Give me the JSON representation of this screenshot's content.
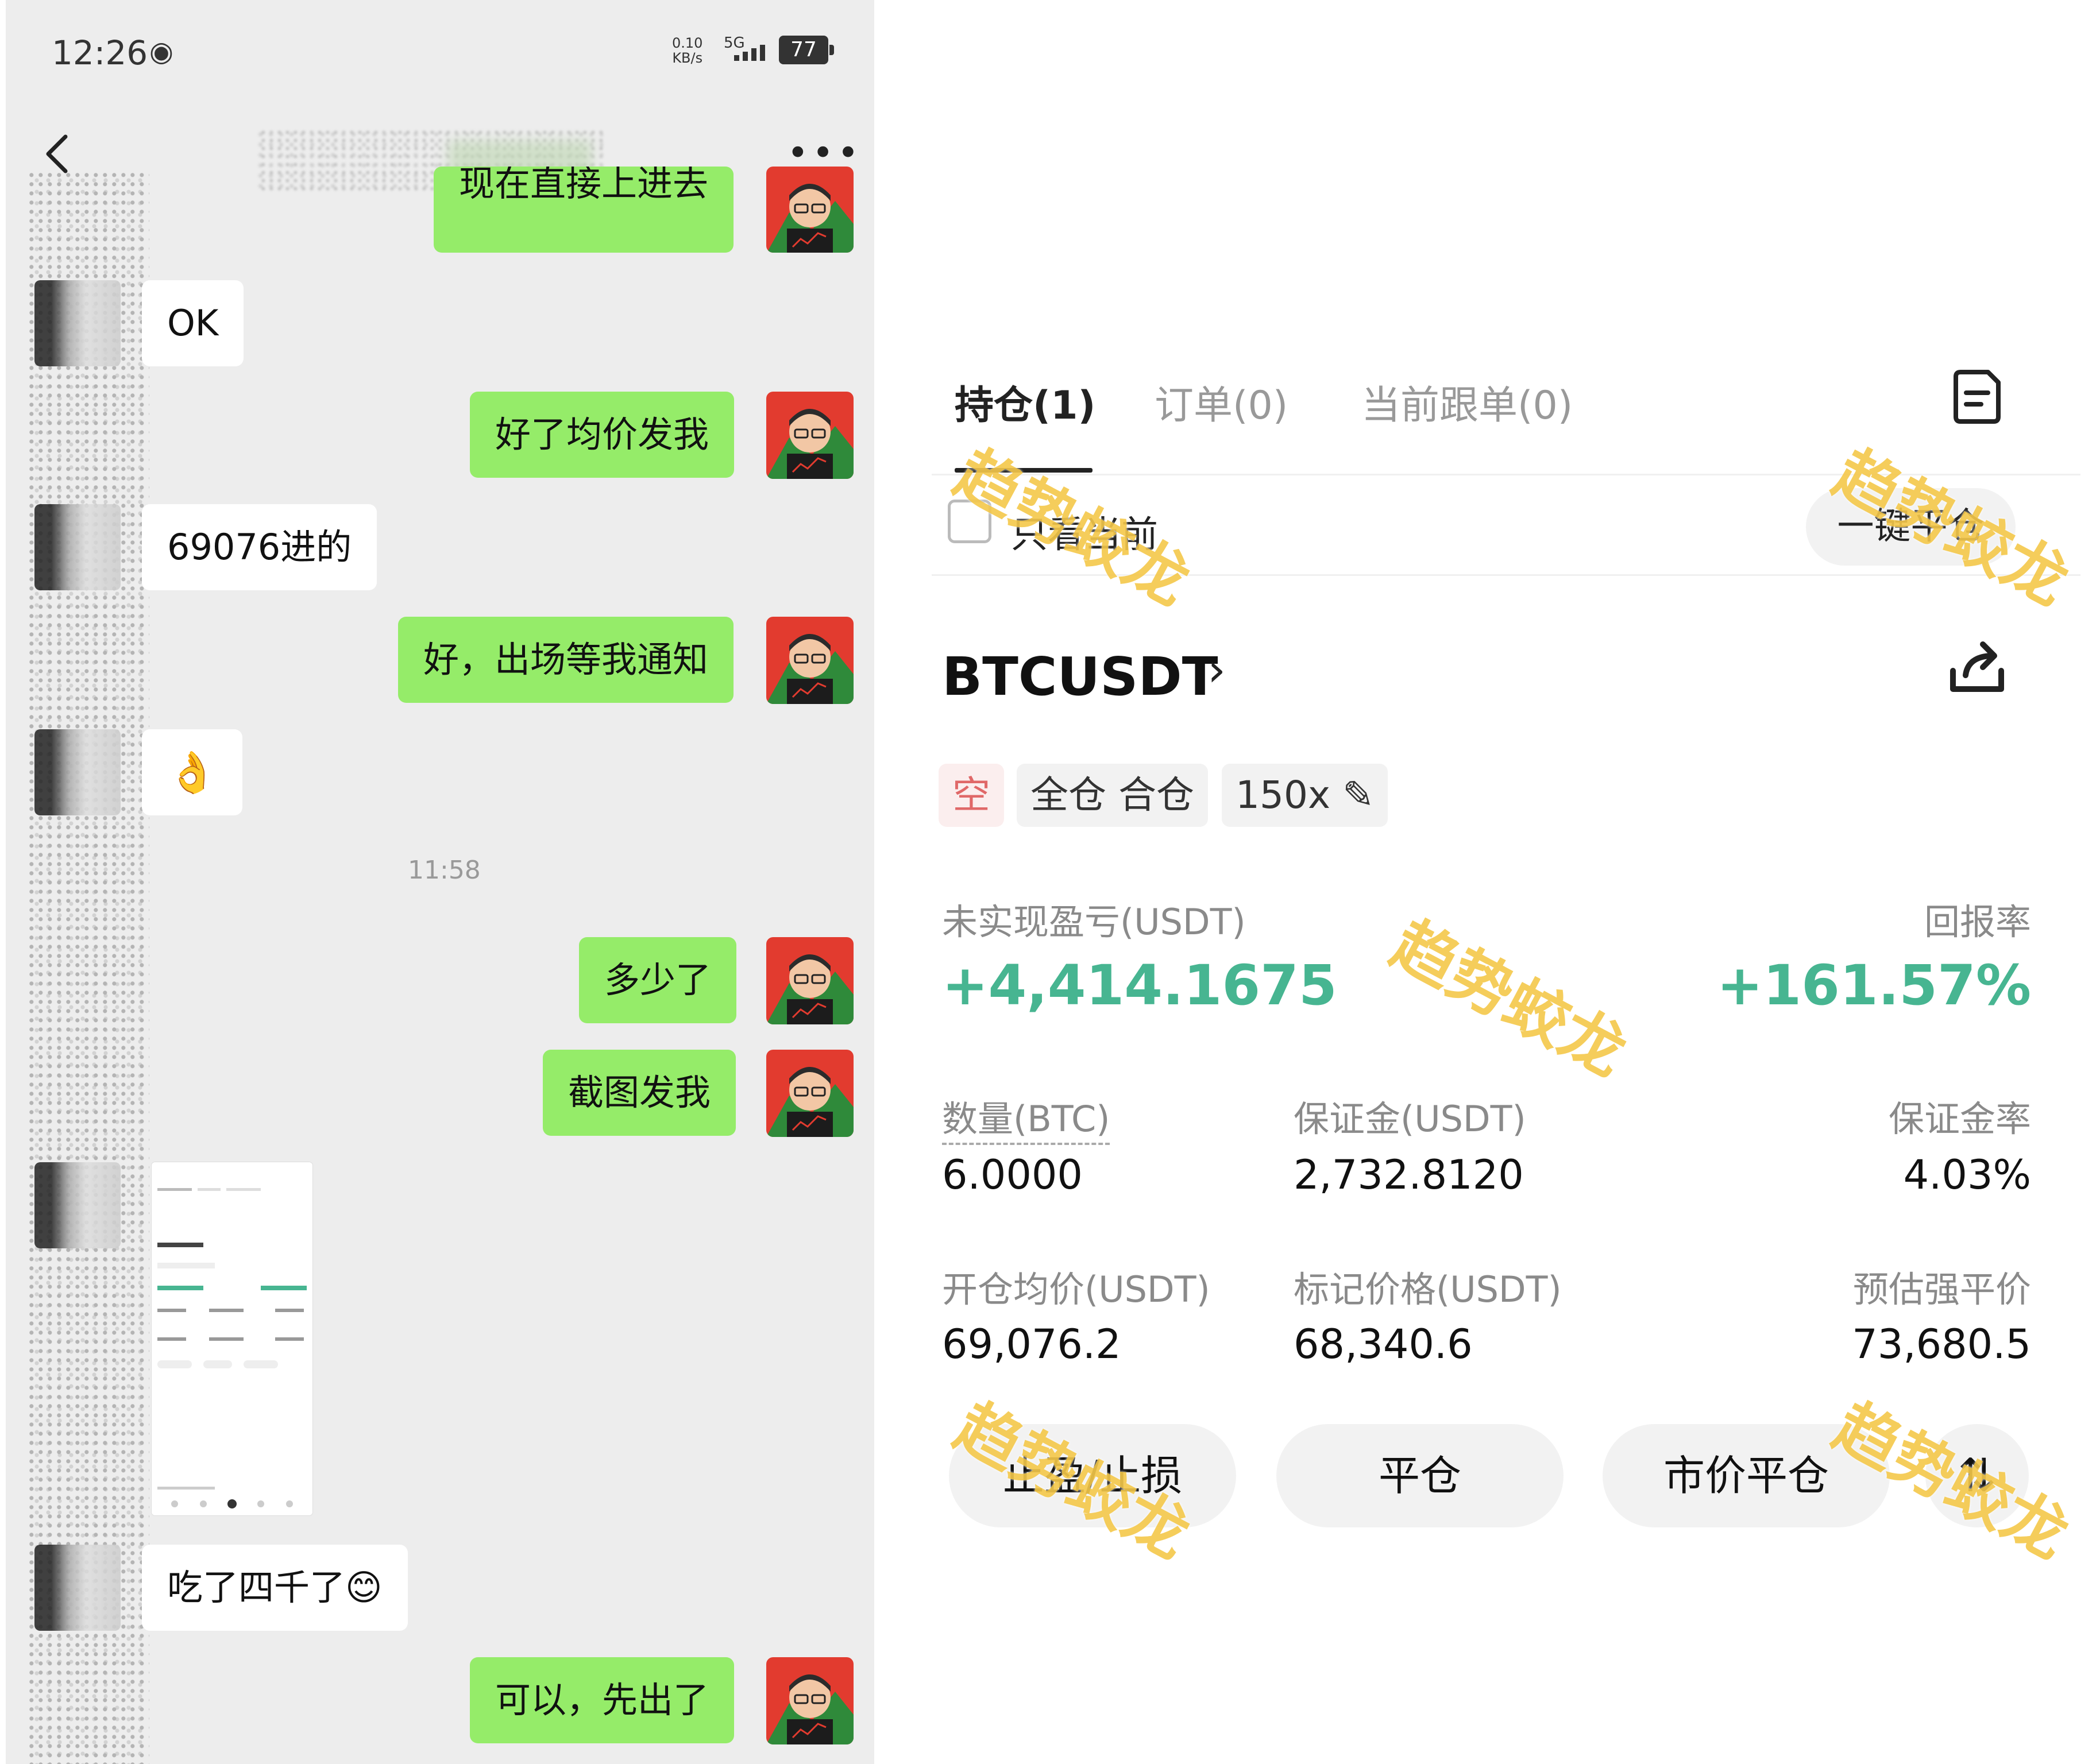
{
  "status_bar": {
    "time": "12:26",
    "net_speed": "0.10",
    "net_unit": "KB/s",
    "network": "5G",
    "battery": "77"
  },
  "chat": {
    "messages": [
      {
        "side": "me",
        "text": "现在直接上进去"
      },
      {
        "side": "them",
        "text": "OK"
      },
      {
        "side": "me",
        "text": "好了均价发我"
      },
      {
        "side": "them",
        "text": "69076进的"
      },
      {
        "side": "me",
        "text": "好，出场等我通知"
      },
      {
        "side": "them",
        "text": "👌"
      },
      {
        "side": "me",
        "text": "多少了"
      },
      {
        "side": "me",
        "text": "截图发我"
      },
      {
        "side": "them",
        "text": "吃了四千了😊"
      },
      {
        "side": "me",
        "text": "可以，先出了"
      }
    ],
    "timestamp": "11:58"
  },
  "trade": {
    "tabs": [
      "持仓(1)",
      "订单(0)",
      "当前跟单(0)"
    ],
    "filter_label": "只看当前",
    "close_all_label": "一键平仓",
    "symbol": "BTCUSDT",
    "tags": {
      "side": "空",
      "mode": "全仓 合仓",
      "leverage": "150x"
    },
    "pnl_label": "未实现盈亏(USDT)",
    "pnl_value": "+4,414.1675",
    "roe_label": "回报率",
    "roe_value": "+161.57%",
    "qty_label": "数量(BTC)",
    "qty_value": "6.0000",
    "margin_label": "保证金(USDT)",
    "margin_value": "2,732.8120",
    "margin_rate_label": "保证金率",
    "margin_rate_value": "4.03%",
    "entry_label": "开仓均价(USDT)",
    "entry_value": "69,076.2",
    "mark_label": "标记价格(USDT)",
    "mark_value": "68,340.6",
    "liq_label": "预估强平价",
    "liq_value": "73,680.5",
    "actions": [
      "止盈/止损",
      "平仓",
      "市价平仓"
    ],
    "watermark": "趋势蛟龙"
  },
  "colors": {
    "chat_bg": "#ededed",
    "me_bubble": "#95ec69",
    "profit_green": "#47b591",
    "short_red": "#e06868",
    "watermark": "#f5c84a"
  }
}
